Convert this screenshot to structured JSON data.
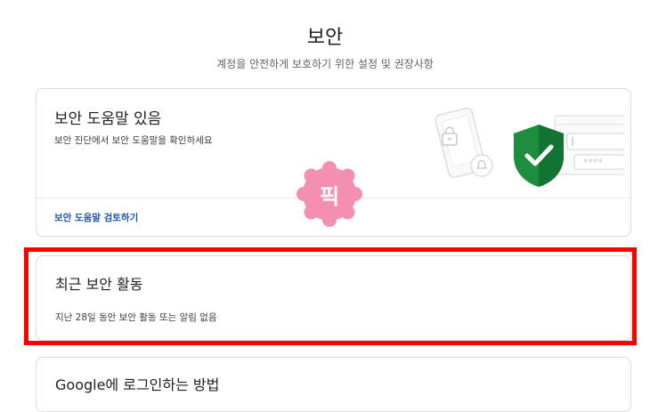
{
  "page": {
    "title": "보안",
    "subtitle": "계정을 안전하게 보호하기 위한 설정 및 권장사항"
  },
  "security_checkup_card": {
    "title": "보안 도움말 있음",
    "description": "보안 진단에서 보안 도움말을 확인하세요",
    "link_label": "보안 도움말 검토하기",
    "masked_password": "****"
  },
  "sticker": {
    "label": "픽",
    "color": "#f48fb1"
  },
  "recent_activity_card": {
    "title": "최근 보안 활동",
    "description": "지난 28일 동안 보안 활동 또는 알림 없음"
  },
  "next_card": {
    "title": "Google에 로그인하는 방법"
  },
  "colors": {
    "highlight": "#ff0000",
    "link": "#1a56a8",
    "shield": "#1e8e3e"
  }
}
